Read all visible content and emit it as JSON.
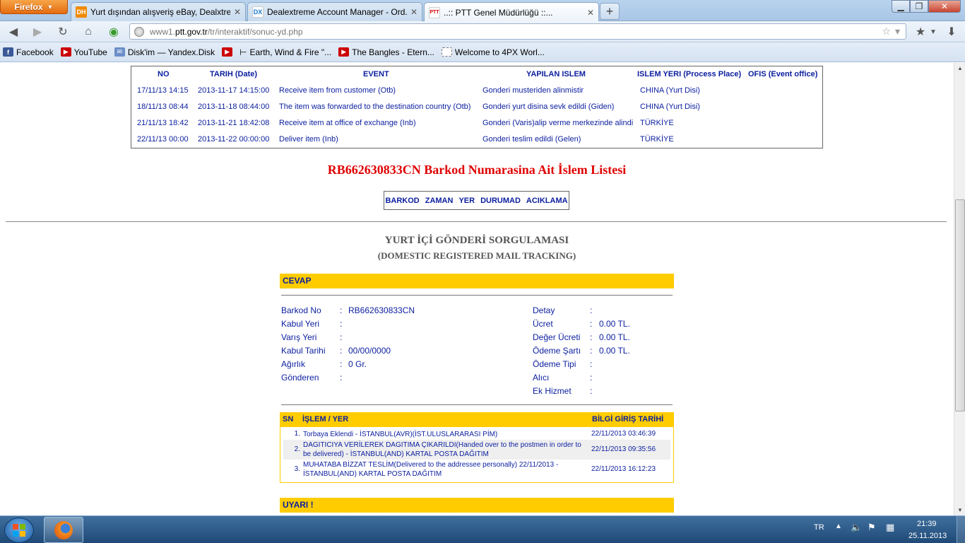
{
  "browser": {
    "app_button": "Firefox",
    "tabs": [
      {
        "favicon": "DH",
        "label": "Yurt dışından alışveriş eBay, Dealxtre...",
        "active": false
      },
      {
        "favicon": "DX",
        "label": "Dealextreme Account Manager - Ord...",
        "active": false
      },
      {
        "favicon": "PTT",
        "label": "..:: PTT Genel Müdürlüğü ::...",
        "active": true
      }
    ],
    "url": {
      "prefix": "www1.",
      "host": "ptt.gov.tr",
      "path": "/tr/interaktif/sonuc-yd.php"
    },
    "bookmarks": [
      {
        "label": "Facebook",
        "icon": "facebook-icon",
        "color": "#3b5998",
        "glyph": "f"
      },
      {
        "label": "YouTube",
        "icon": "youtube-icon",
        "color": "#cc0000",
        "glyph": "▶"
      },
      {
        "label": "Disk'im — Yandex.Disk",
        "icon": "mail-icon",
        "color": "#6b8fc9",
        "glyph": "✉"
      },
      {
        "label": "",
        "icon": "youtube-icon",
        "color": "#cc0000",
        "glyph": "▶"
      },
      {
        "label": "Earth, Wind & Fire \"...",
        "icon": "cursor-icon",
        "color": "#000000",
        "glyph": "⊢"
      },
      {
        "label": "The Bangles - Etern...",
        "icon": "youtube-icon",
        "color": "#cc0000",
        "glyph": "▶"
      },
      {
        "label": "Welcome to 4PX Worl...",
        "icon": "page-icon",
        "color": "#ffffff",
        "glyph": ""
      }
    ]
  },
  "intl_table": {
    "headers": [
      "NO",
      "TARIH (Date)",
      "EVENT",
      "YAPILAN ISLEM",
      "ISLEM YERI (Process Place)",
      "OFIS (Event office)"
    ],
    "rows": [
      [
        "17/11/13 14:15",
        "2013-11-17 14:15:00",
        "Receive item from customer (Otb)",
        "Gonderi musteriden alinmistir",
        "CHINA (Yurt Disi)",
        ""
      ],
      [
        "18/11/13 08:44",
        "2013-11-18 08:44:00",
        "The item was forwarded to the destination country (Otb)",
        "Gonderi yurt disina sevk edildi (Giden)",
        "CHINA (Yurt Disi)",
        ""
      ],
      [
        "21/11/13 18:42",
        "2013-11-21 18:42:08",
        "Receive item at office of exchange (Inb)",
        "Gonderi (Varis)alip verme merkezinde alindi",
        "TÜRKİYE",
        ""
      ],
      [
        "22/11/13 00:00",
        "2013-11-22 00:00:00",
        "Deliver item (Inb)",
        "Gonderi teslim edildi (Gelen)",
        "TÜRKİYE",
        ""
      ]
    ]
  },
  "barcode_title": "RB662630833CN Barkod Numarasina Ait İslem Listesi",
  "legend": [
    "BARKOD",
    "ZAMAN",
    "YER",
    "DURUMAD",
    "ACIKLAMA"
  ],
  "domestic": {
    "title": "YURT İÇİ GÖNDERİ SORGULAMASI",
    "subtitle": "(DOMESTIC REGISTERED MAIL TRACKING)",
    "cevap": "CEVAP",
    "left_fields": [
      {
        "label": "Barkod No",
        "value": "RB662630833CN"
      },
      {
        "label": "Kabul Yeri",
        "value": ""
      },
      {
        "label": "Varış Yeri",
        "value": ""
      },
      {
        "label": "Kabul Tarihi",
        "value": "00/00/0000"
      },
      {
        "label": "Ağırlık",
        "value": "0 Gr."
      },
      {
        "label": "Gönderen",
        "value": ""
      }
    ],
    "right_fields": [
      {
        "label": "Detay",
        "value": ""
      },
      {
        "label": "Ücret",
        "value": "0.00 TL."
      },
      {
        "label": "Değer Ücreti",
        "value": "0.00 TL."
      },
      {
        "label": "Ödeme Şartı",
        "value": "0.00 TL."
      },
      {
        "label": "Ödeme Tipi",
        "value": ""
      },
      {
        "label": "Alıcı",
        "value": ""
      },
      {
        "label": "Ek Hizmet",
        "value": ""
      }
    ],
    "separator": ":",
    "history_headers": {
      "sn": "SN",
      "action": "İŞLEM / YER",
      "date": "BİLGİ GİRİŞ TARİHİ"
    },
    "history": [
      {
        "sn": "1.",
        "desc": "Torbaya Eklendi - İSTANBUL(AVR)(İST.ULUSLARARASI PİM)",
        "date": "22/11/2013 03:46:39"
      },
      {
        "sn": "2.",
        "desc": "DAGITICIYA VERİLEREK DAGITIMA ÇIKARILDI(Handed over to the postmen in order to be delivered) - İSTANBUL(AND) KARTAL POSTA DAĞITIM",
        "date": "22/11/2013 09:35:56"
      },
      {
        "sn": "3.",
        "desc": "MUHATABA BİZZAT TESLİM(Delivered to the addressee personally) 22/11/2013 - İSTANBUL(AND) KARTAL POSTA DAĞITIM",
        "date": "22/11/2013 16:12:23"
      }
    ],
    "warning": "UYARI !"
  },
  "taskbar": {
    "language": "TR",
    "time": "21:39",
    "date": "25.11.2013"
  },
  "colors": {
    "accent_yellow": "#ffcc00",
    "link_blue": "#0a1e9e",
    "title_red": "#e00000"
  }
}
